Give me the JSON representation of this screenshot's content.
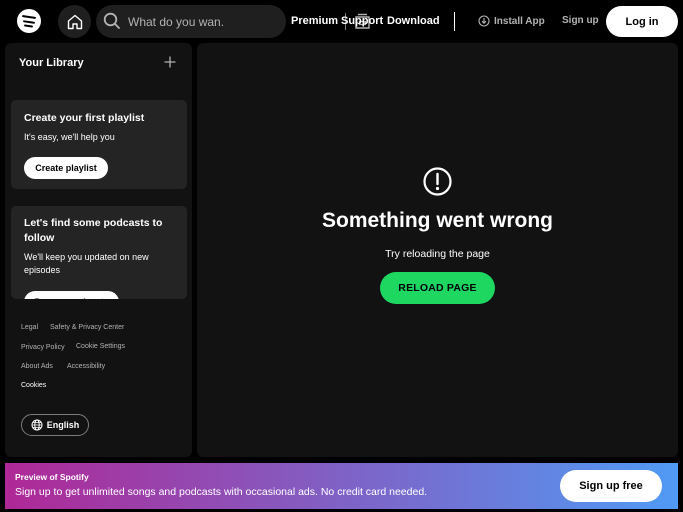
{
  "topbar": {
    "logo_icon": "spotify-logo-icon",
    "home_icon": "home-icon",
    "search_placeholder": "What do you wan...",
    "search_icon": "search-icon",
    "browse_icon": "browse-icon",
    "nav": [
      "Premium",
      "Support",
      "Download"
    ],
    "install_label": "Install App",
    "signup_label": "Sign up",
    "login_label": "Log in"
  },
  "sidebar": {
    "title": "Your Library",
    "card1": {
      "title": "Create your first playlist",
      "subtitle": "It's easy, we'll help you",
      "button": "Create playlist"
    },
    "card2": {
      "title": "Let's find some podcasts to follow",
      "subtitle": "We'll keep you updated on new episodes",
      "button": "Browse podcasts"
    },
    "footer_links": [
      "Legal",
      "Safety & Privacy Center",
      "Privacy Policy",
      "Cookie Settings",
      "About Ads",
      "Accessibility",
      "Cookies"
    ],
    "language": "English"
  },
  "main": {
    "error_title": "Something went wrong",
    "error_subtitle": "Try reloading the page",
    "reload_label": "RELOAD PAGE"
  },
  "banner": {
    "title": "Preview of Spotify",
    "text": "Sign up to get unlimited songs and podcasts with occasional ads. No credit card needed.",
    "button": "Sign up free"
  },
  "colors": {
    "accent_green": "#1ed760",
    "background": "#000000",
    "panel": "#121212",
    "card": "#242424",
    "banner_start": "#af2896",
    "banner_end": "#509bf5"
  }
}
